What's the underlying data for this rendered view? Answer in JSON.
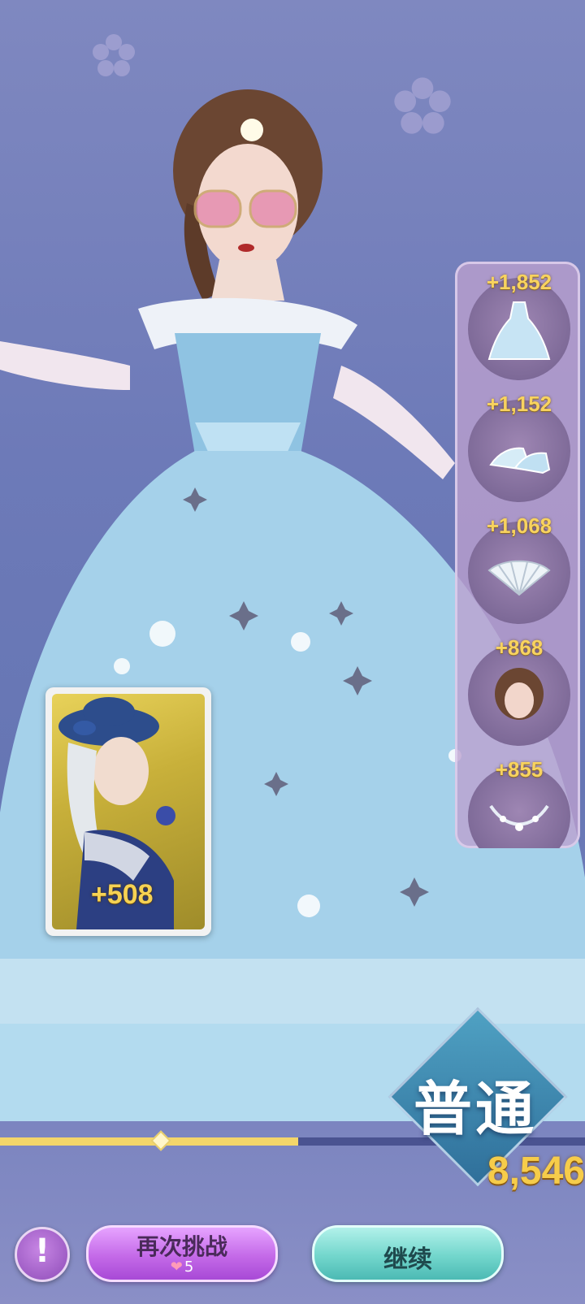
{
  "rewards": [
    {
      "value": "+1,852",
      "icon": "dress-icon"
    },
    {
      "value": "+1,152",
      "icon": "shoes-icon"
    },
    {
      "value": "+1,068",
      "icon": "fan-icon"
    },
    {
      "value": "+868",
      "icon": "hairstyle-icon"
    },
    {
      "value": "+855",
      "icon": "necklace-icon"
    }
  ],
  "card": {
    "bonus": "+508"
  },
  "rank": {
    "label": "普通"
  },
  "score": "8,546",
  "progress": {
    "fraction": 0.51
  },
  "buttons": {
    "retry_label": "再次挑战",
    "retry_cost": "5",
    "continue_label": "继续"
  },
  "colors": {
    "gold": "#f6cc4a",
    "retry": "#c46ae8",
    "continue": "#72d6cc"
  }
}
